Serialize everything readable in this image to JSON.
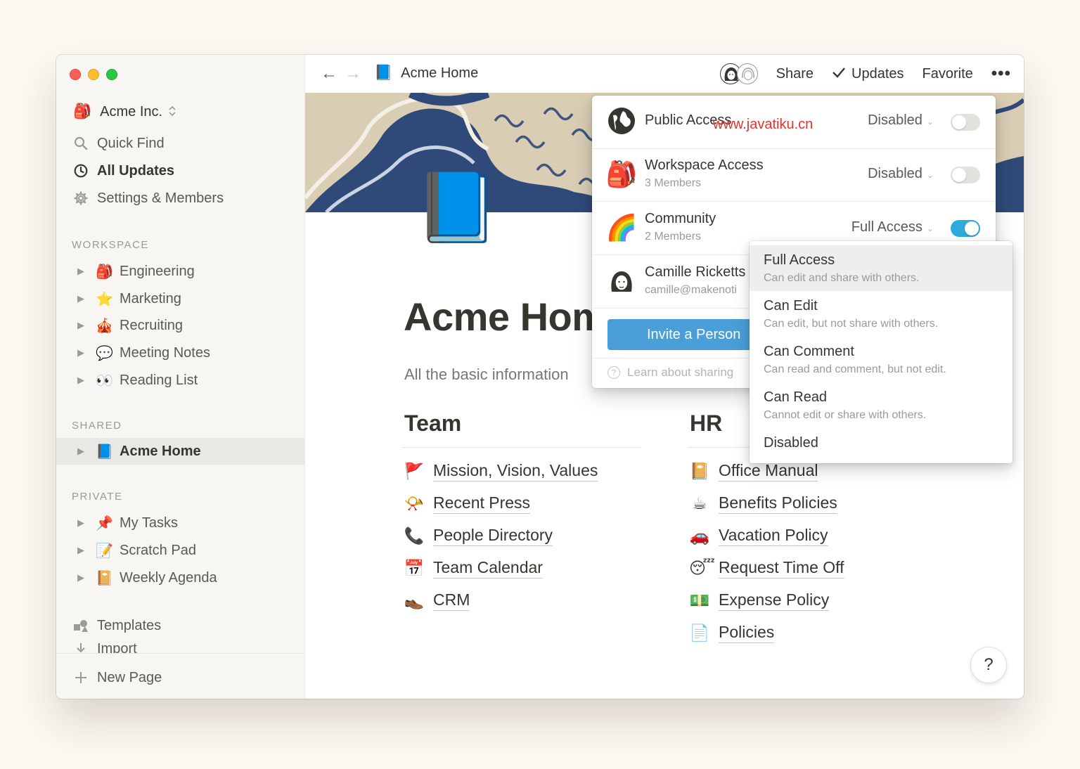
{
  "window": {
    "controls": [
      "close",
      "minimize",
      "zoom"
    ]
  },
  "sidebar": {
    "workspace": {
      "emoji": "🎒",
      "name": "Acme Inc.",
      "switch_icon": "⌃"
    },
    "top_items": [
      {
        "icon": "search-icon",
        "label": "Quick Find"
      },
      {
        "icon": "clock-icon",
        "label": "All Updates"
      },
      {
        "icon": "gear-icon",
        "label": "Settings & Members"
      }
    ],
    "sections": [
      {
        "label": "WORKSPACE",
        "items": [
          {
            "emoji": "🎒",
            "label": "Engineering"
          },
          {
            "emoji": "⭐",
            "label": "Marketing"
          },
          {
            "emoji": "🎪",
            "label": "Recruiting"
          },
          {
            "emoji": "💬",
            "label": "Meeting Notes"
          },
          {
            "emoji": "👀",
            "label": "Reading List"
          }
        ]
      },
      {
        "label": "SHARED",
        "items": [
          {
            "emoji": "📘",
            "label": "Acme Home"
          }
        ]
      },
      {
        "label": "PRIVATE",
        "items": [
          {
            "emoji": "📌",
            "label": "My Tasks"
          },
          {
            "emoji": "📝",
            "label": "Scratch Pad"
          },
          {
            "emoji": "📔",
            "label": "Weekly Agenda"
          }
        ]
      }
    ],
    "bottom_items": [
      {
        "icon": "templates-icon",
        "label": "Templates"
      },
      {
        "icon": "import-icon",
        "label": "Import"
      }
    ],
    "new_page_label": "New Page"
  },
  "topbar": {
    "back_arrow": "←",
    "forward_arrow": "→",
    "breadcrumb": {
      "emoji": "📘",
      "title": "Acme Home"
    },
    "share_label": "Share",
    "updates_label": "Updates",
    "favorite_label": "Favorite",
    "more_label": "•••"
  },
  "page": {
    "icon": "📘",
    "title": "Acme Home",
    "description": "All the basic information",
    "columns": [
      {
        "heading": "Team",
        "links": [
          {
            "emoji": "🚩",
            "label": "Mission, Vision, Values"
          },
          {
            "emoji": "📯",
            "label": "Recent Press"
          },
          {
            "emoji": "📞",
            "label": "People Directory"
          },
          {
            "emoji": "📅",
            "label": "Team Calendar"
          },
          {
            "emoji": "👞",
            "label": "CRM"
          }
        ]
      },
      {
        "heading": "HR",
        "links": [
          {
            "emoji": "📔",
            "label": "Office Manual"
          },
          {
            "emoji": "☕",
            "label": "Benefits Policies"
          },
          {
            "emoji": "🚗",
            "label": "Vacation Policy"
          },
          {
            "emoji": "😴",
            "label": "Request Time Off"
          },
          {
            "emoji": "💵",
            "label": "Expense Policy"
          },
          {
            "emoji": "📄",
            "label": "Policies"
          }
        ]
      }
    ],
    "help_label": "?"
  },
  "share_popup": {
    "rows": [
      {
        "icon": "globe-icon",
        "title": "Public Access",
        "subtitle": "",
        "permission": "Disabled",
        "toggle_on": false
      },
      {
        "icon": "backpack-icon",
        "title": "Workspace Access",
        "subtitle": "3 Members",
        "permission": "Disabled",
        "toggle_on": false
      },
      {
        "icon": "rainbow-icon",
        "title": "Community",
        "subtitle": "2 Members",
        "permission": "Full Access",
        "toggle_on": true
      },
      {
        "icon": "person-avatar-icon",
        "title": "Camille Ricketts",
        "subtitle": "camille@makenoti",
        "permission": "",
        "toggle_on": false
      }
    ],
    "watermark": "www.javatiku.cn",
    "invite_label": "Invite a Person",
    "learn_label": "Learn about sharing"
  },
  "permission_menu": {
    "selected": "Full Access",
    "options": [
      {
        "title": "Full Access",
        "description": "Can edit and share with others."
      },
      {
        "title": "Can Edit",
        "description": "Can edit, but not share with others."
      },
      {
        "title": "Can Comment",
        "description": "Can read and comment, but not edit."
      },
      {
        "title": "Can Read",
        "description": "Cannot edit or share with others."
      },
      {
        "title": "Disabled",
        "description": ""
      }
    ]
  },
  "colors": {
    "background": "#fcf8f2",
    "sidebar": "#f7f6f3",
    "accent_blue": "#2eaadc",
    "invite_button": "#4a9fd8",
    "text": "#37352f"
  }
}
